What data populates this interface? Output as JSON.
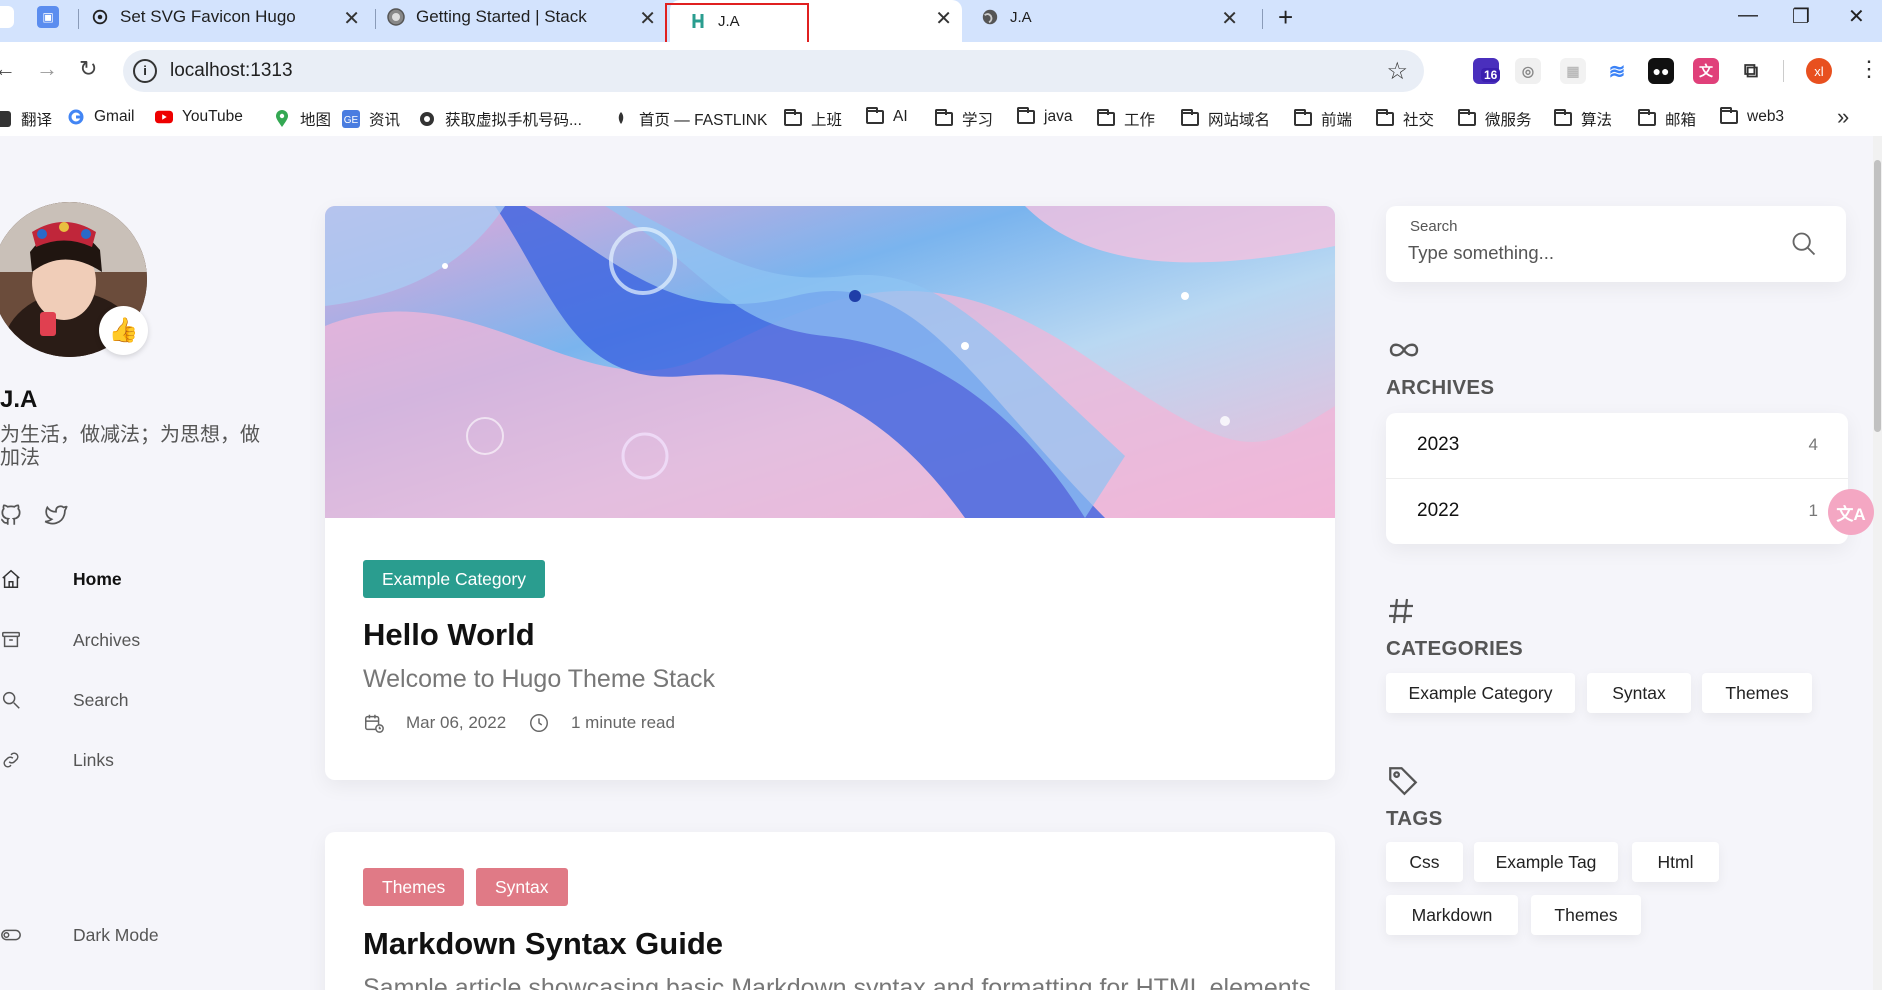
{
  "browser": {
    "tabs": [
      {
        "title": "Set SVG Favicon Hugo"
      },
      {
        "title": "Getting Started | Stack"
      },
      {
        "title": "J.A"
      },
      {
        "title": "J.A"
      }
    ],
    "new_tab": "+",
    "url": "localhost:1313",
    "extension_badge": "16",
    "profile_initials": "xl",
    "bookmarks": [
      {
        "label": "翻译",
        "icon": "translate-icon"
      },
      {
        "label": "Gmail",
        "icon": "google-icon"
      },
      {
        "label": "YouTube",
        "icon": "youtube-icon"
      },
      {
        "label": "地图",
        "icon": "maps-pin-icon"
      },
      {
        "label": "资讯",
        "icon": "news-icon"
      },
      {
        "label": "获取虚拟手机号码...",
        "icon": "site-icon"
      },
      {
        "label": "首页 — FASTLINK",
        "icon": "rocket-icon"
      },
      {
        "label": "上班",
        "icon": "folder-icon"
      },
      {
        "label": "AI",
        "icon": "folder-icon"
      },
      {
        "label": "学习",
        "icon": "folder-icon"
      },
      {
        "label": "java",
        "icon": "folder-icon"
      },
      {
        "label": "工作",
        "icon": "folder-icon"
      },
      {
        "label": "网站域名",
        "icon": "folder-icon"
      },
      {
        "label": "前端",
        "icon": "folder-icon"
      },
      {
        "label": "社交",
        "icon": "folder-icon"
      },
      {
        "label": "微服务",
        "icon": "folder-icon"
      },
      {
        "label": "算法",
        "icon": "folder-icon"
      },
      {
        "label": "邮箱",
        "icon": "folder-icon"
      },
      {
        "label": "web3",
        "icon": "folder-icon"
      }
    ],
    "bookmarks_overflow": "»"
  },
  "sidebar": {
    "emoji": "👍",
    "site_name": "J.A",
    "site_description": "为生活，做减法；为思想，做加法",
    "social": [
      "github-icon",
      "twitter-icon"
    ],
    "menu": [
      {
        "label": "Home",
        "icon": "home-icon",
        "active": true
      },
      {
        "label": "Archives",
        "icon": "archive-icon",
        "active": false
      },
      {
        "label": "Search",
        "icon": "search-icon",
        "active": false
      },
      {
        "label": "Links",
        "icon": "link-icon",
        "active": false
      }
    ],
    "dark_mode_label": "Dark Mode"
  },
  "posts": [
    {
      "categories": [
        {
          "label": "Example Category",
          "color": "#2a9d8f"
        }
      ],
      "title": "Hello World",
      "subtitle": "Welcome to Hugo Theme Stack",
      "date": "Mar 06, 2022",
      "read_time": "1 minute read"
    },
    {
      "categories": [
        {
          "label": "Themes",
          "color": "#e07a86"
        },
        {
          "label": "Syntax",
          "color": "#e07a86"
        }
      ],
      "title": "Markdown Syntax Guide",
      "subtitle": "Sample article showcasing basic Markdown syntax and formatting for HTML elements."
    }
  ],
  "right": {
    "search": {
      "label": "Search",
      "placeholder": "Type something..."
    },
    "archives": {
      "title": "ARCHIVES",
      "items": [
        {
          "year": "2023",
          "count": "4"
        },
        {
          "year": "2022",
          "count": "1"
        }
      ]
    },
    "categories": {
      "title": "CATEGORIES",
      "items": [
        "Example Category",
        "Syntax",
        "Themes"
      ]
    },
    "tags": {
      "title": "TAGS",
      "items": [
        "Css",
        "Example Tag",
        "Html",
        "Markdown",
        "Themes"
      ]
    }
  },
  "colors": {
    "accent_green": "#2a9d8f",
    "accent_pink": "#e07a86",
    "tab_strip": "#d3e3fd"
  }
}
